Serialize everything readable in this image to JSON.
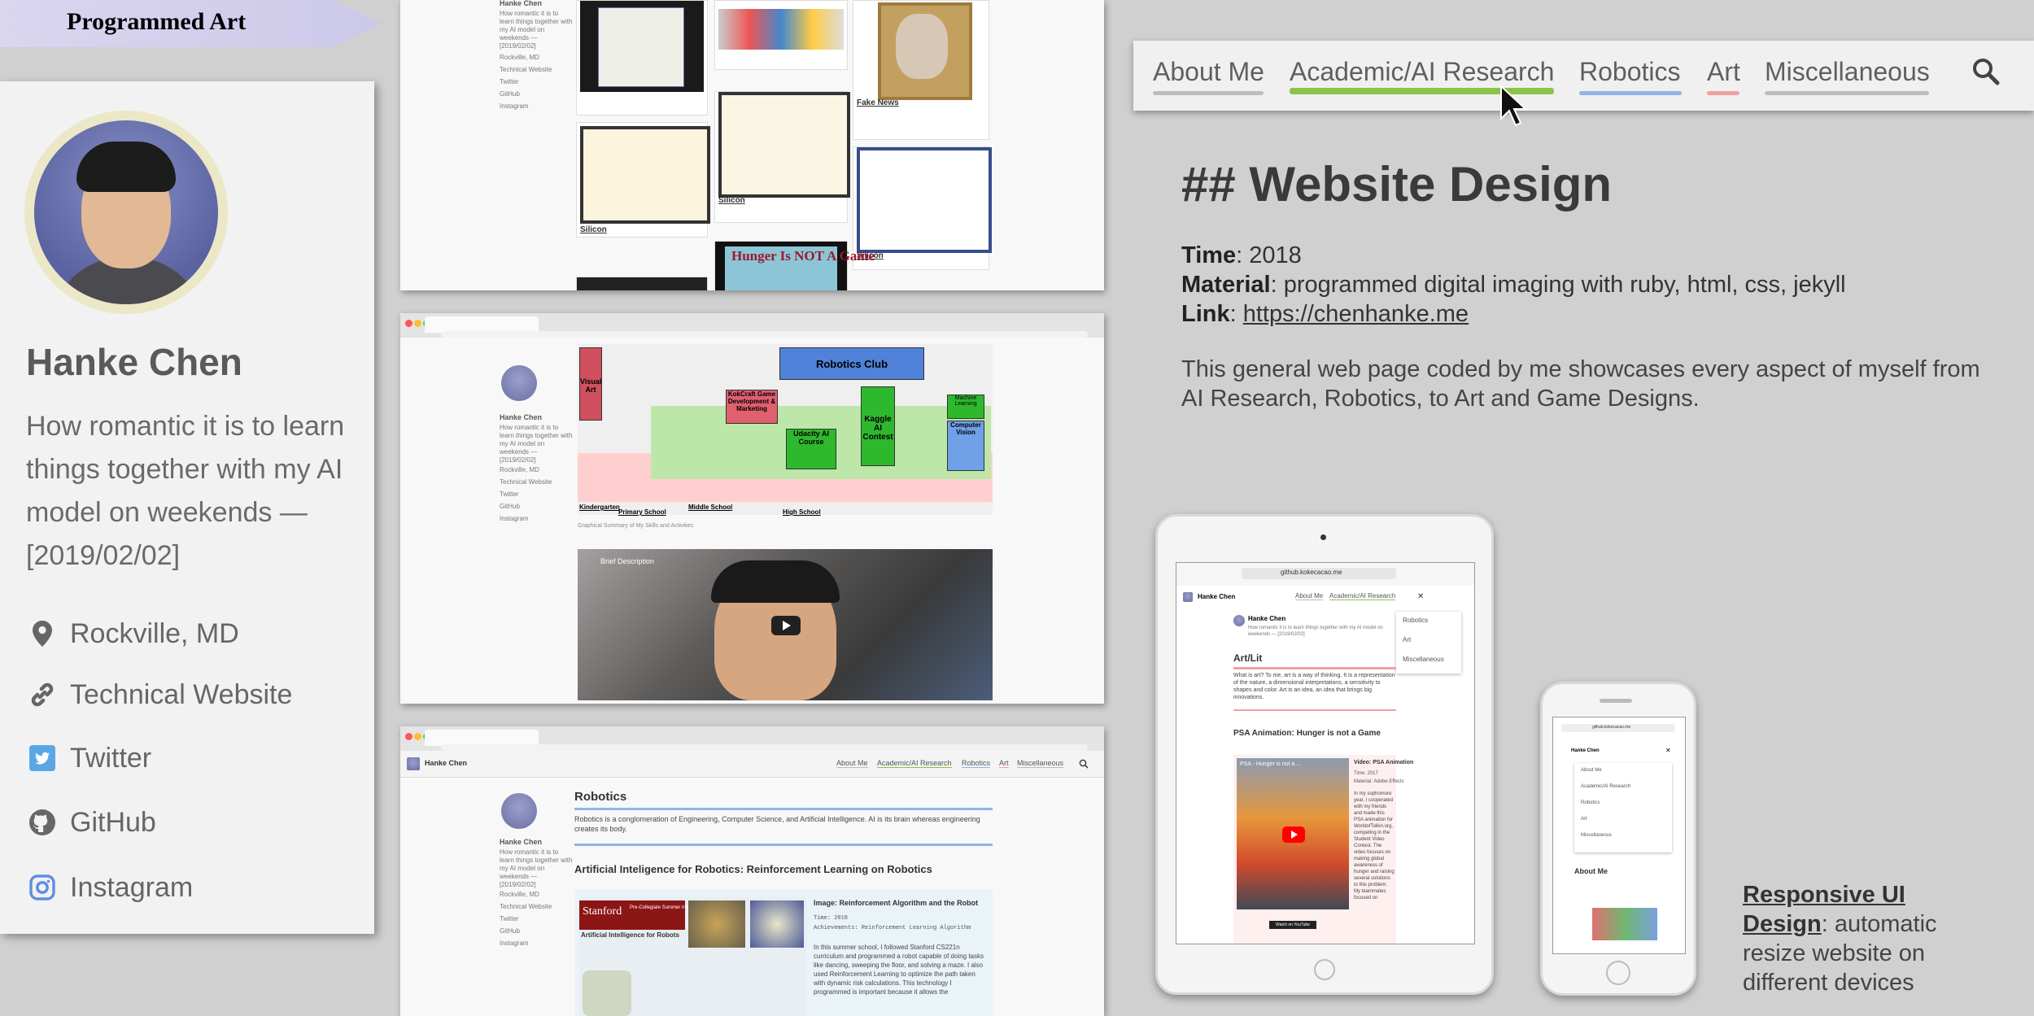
{
  "banner": {
    "title": "Programmed Art"
  },
  "profile": {
    "name": "Hanke Chen",
    "bio": "How romantic it is to learn things together with my AI model on weekends — [2019/02/02]",
    "links": [
      {
        "label": "Rockville, MD",
        "icon": "map-pin-icon"
      },
      {
        "label": "Technical Website",
        "icon": "link-icon"
      },
      {
        "label": "Twitter",
        "icon": "twitter-icon"
      },
      {
        "label": "GitHub",
        "icon": "github-icon"
      },
      {
        "label": "Instagram",
        "icon": "instagram-icon"
      }
    ]
  },
  "nav": {
    "items": [
      {
        "label": "About Me",
        "color": "#bdbdbd"
      },
      {
        "label": "Academic/AI Research",
        "color": "#8bc34a"
      },
      {
        "label": "Robotics",
        "color": "#90b4e8"
      },
      {
        "label": "Art",
        "color": "#f0a0a0"
      },
      {
        "label": "Miscellaneous",
        "color": "#bdbdbd"
      }
    ],
    "active": "Academic/AI Research",
    "search_icon": "search-icon"
  },
  "content": {
    "heading": "## Website Design",
    "time_label": "Time",
    "time_value": "2018",
    "material_label": "Material",
    "material_value": "programmed digital imaging with ruby, html, css, jekyll",
    "link_label": "Link",
    "link_value": "https://chenhanke.me",
    "description": "This general web page coded by me showcases every aspect of myself from AI Research, Robotics, to Art and Game Designs.",
    "responsive_title": "Responsive UI Design",
    "responsive_text": "automatic resize website on different devices"
  },
  "shot1": {
    "sidebar_name": "Hanke Chen",
    "sidebar_bio": "How romantic it is to learn things together with my AI model on weekends — [2019/02/02]",
    "sidebar_links": [
      "Rockville, MD",
      "Technical Website",
      "Twitter",
      "GitHub",
      "Instagram"
    ],
    "tile_fake_news": "Fake News",
    "tile_silicon": "Silicon",
    "tile_hunger": "Hunger Is NOT A Game"
  },
  "shot2": {
    "sidebar_name": "Hanke Chen",
    "sidebar_bio": "How romantic it is to learn things together with my AI model on weekends — [2019/02/02]",
    "sidebar_links": [
      "Rockville, MD",
      "Technical Website",
      "Twitter",
      "GitHub",
      "Instagram"
    ],
    "diagram": {
      "robotics_club": "Robotics Club",
      "visual_art": "Visual Art",
      "kokcraft": "KokCraft Game Development & Marketing",
      "kaggle": "Kaggle AI Contest",
      "udacity": "Udacity AI Course",
      "computer_vision": "Computer Vision",
      "machine_learning": "Machine Learning",
      "kindergarten": "Kindergarten",
      "primary": "Primary School",
      "middle": "Middle School",
      "high": "High School",
      "caption": "Graphical Summary of My Skills and Activities"
    },
    "video_label": "Brief Description"
  },
  "shot3": {
    "site_name": "Hanke Chen",
    "nav": [
      "About Me",
      "Academic/AI Research",
      "Robotics",
      "Art",
      "Miscellaneous"
    ],
    "sidebar_name": "Hanke Chen",
    "sidebar_bio": "How romantic it is to learn things together with my AI model on weekends — [2019/02/02]",
    "sidebar_links": [
      "Rockville, MD",
      "Technical Website",
      "Twitter",
      "GitHub",
      "Instagram"
    ],
    "section_title": "Robotics",
    "section_text": "Robotics is a conglomeration of Engineering, Computer Science, and Artificial Intelligence. AI is its brain whereas engineering creates its body.",
    "subsection_title": "Artificial Inteligence for Robotics: Reinforcement Learning on Robotics",
    "card_title": "Image: Reinforcement Algorithm and the Robot",
    "card_time": "Time: 2018",
    "card_achievements": "Achievements: Reinforcement Learning Algorithm",
    "card_body": "In this summer school, I followed Stanford CS221n curriculum and programmed a robot capable of doing tasks like dancing, sweeping the floor, and solving a maze. I also used Reinforcement Learning to optimize the path taken with dynamic risk calculations. This technology I programmed is important because it allows the",
    "stanford_label": "Stanford",
    "stanford_sub": "Pre-Collegiate Summer Institutes",
    "stanford_course": "Artificial Intelligence for Robots"
  },
  "ipad": {
    "url": "github.kokecacao.me",
    "site_name": "Hanke Chen",
    "nav": [
      "About Me",
      "Academic/AI Research"
    ],
    "dropdown": [
      "Robotics",
      "Art",
      "Miscellaneous"
    ],
    "profile_name": "Hanke Chen",
    "profile_bio": "How romantic it is to learn things together with my AI model on weekends — [2019/02/02]",
    "section_title": "Art/Lit",
    "section_text": "What is art? To me, art is a way of thinking. It is a representation of the nature, a dimensional interpretations, a sensitivity to shapes and color. Art is an idea, an idea that brings big innovations.",
    "subsection_title": "PSA Animation: Hunger is not a Game",
    "video_title": "Video: PSA Animation",
    "video_time": "Time: 2017",
    "video_material": "Material: Adobe Effects",
    "video_text": "In my sophomore year, I cooperated with my friends and made this PSA animation for WorldofTolkin.org, competing in the Student Video Contest. The video focuses on making global awareness of hunger and raising several solutions to this problem. My teammates focused on creating the scripts while I animated the video.",
    "video_overlay": "PSA - Hunger is not a ...",
    "watch_label": "Watch on YouTube"
  },
  "iphone": {
    "url": "github.kokecacao.me",
    "site_name": "Hanke Chen",
    "menu": [
      "About Me",
      "Academic/AI Research",
      "Robotics",
      "Art",
      "Miscellaneous"
    ],
    "section_title": "About Me"
  }
}
